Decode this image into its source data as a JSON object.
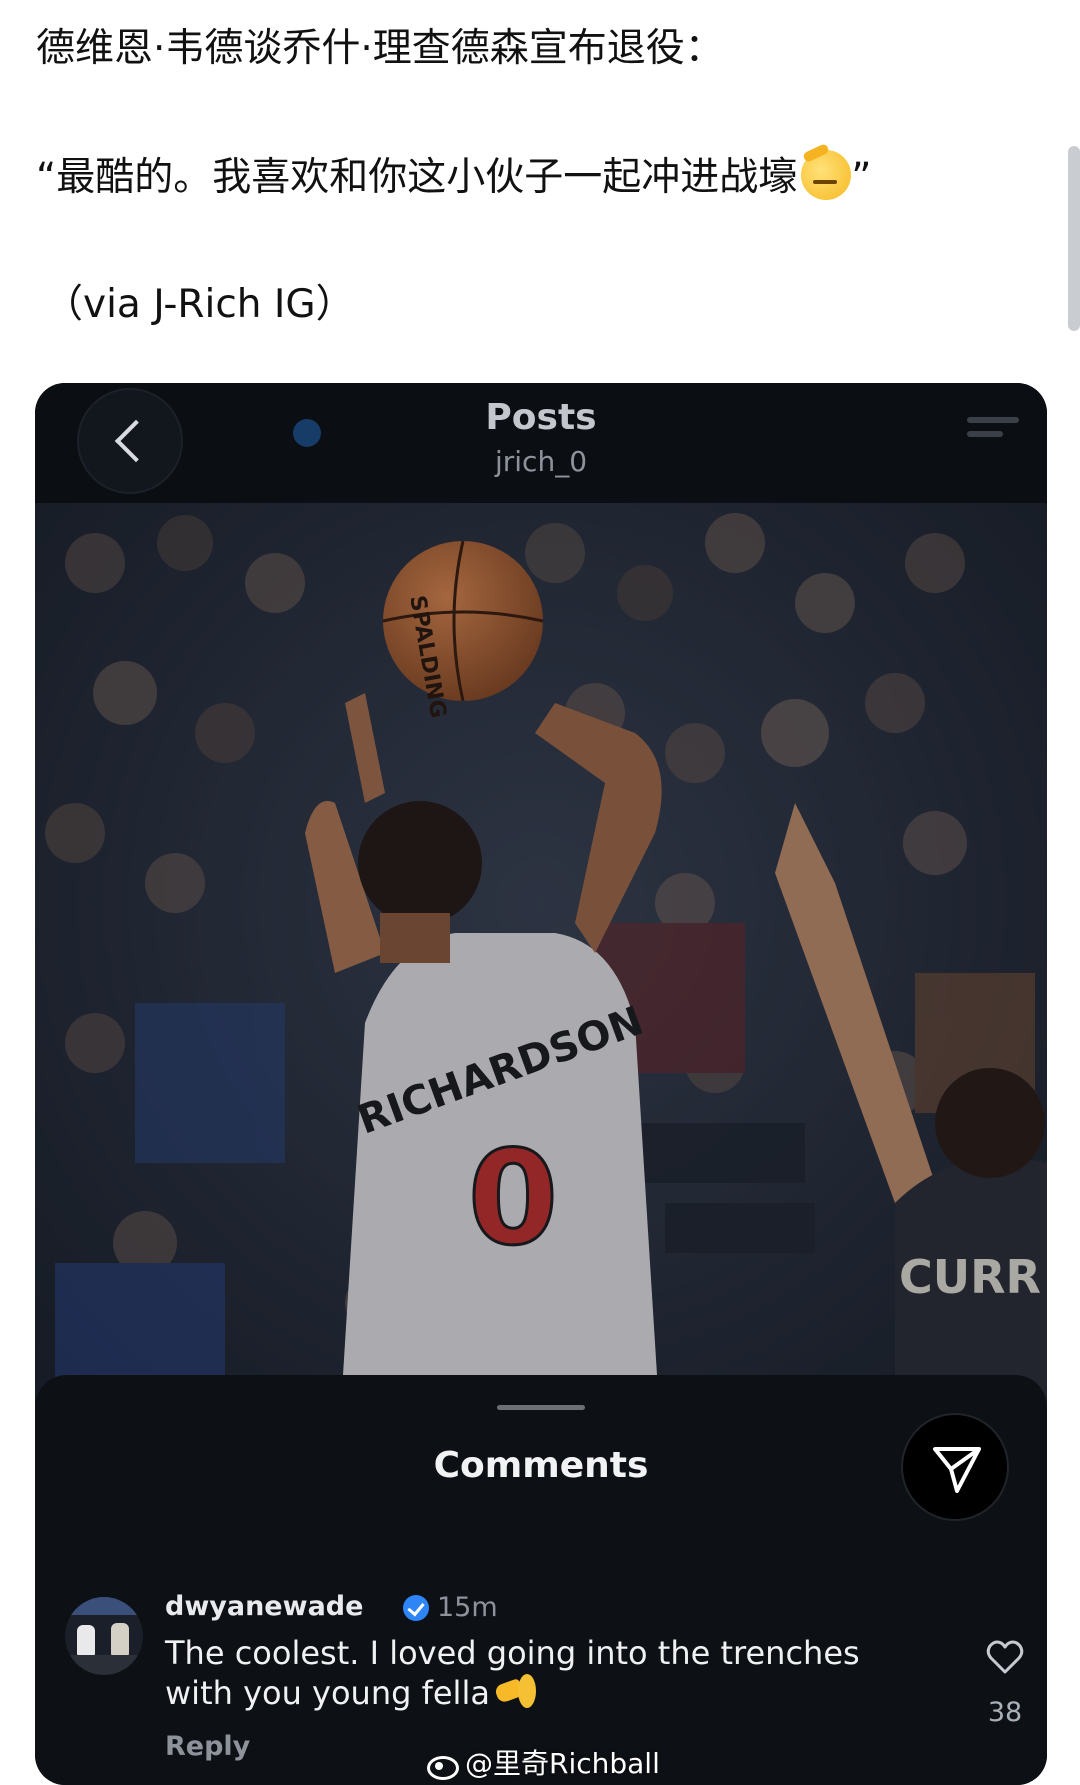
{
  "post": {
    "line1": "德维恩·韦德谈乔什·理查德森宣布退役：",
    "line2": "“最酷的。我喜欢和你这小伙子一起冲进战壕",
    "line2_close": "”",
    "line3": "（via J-Rich IG）"
  },
  "instagram": {
    "header_title": "Posts",
    "header_username": "jrich_0",
    "photo": {
      "ball_brand": "SPALDING",
      "jersey_name": "RICHARDSON",
      "jersey_number": "0",
      "opponent_jersey_name": "CURR"
    },
    "comments_title": "Comments",
    "comment": {
      "username": "dwyanewade",
      "time": "15m",
      "text": "The coolest. I loved going into the trenches with you young fella",
      "reply_label": "Reply",
      "likes": "38"
    }
  },
  "watermark": "@里奇Richball",
  "colors": {
    "card_background": "#0e1116",
    "verified_badge": "#2e86f6",
    "jersey_red": "#c8302e",
    "page_background": "#ffffff"
  }
}
